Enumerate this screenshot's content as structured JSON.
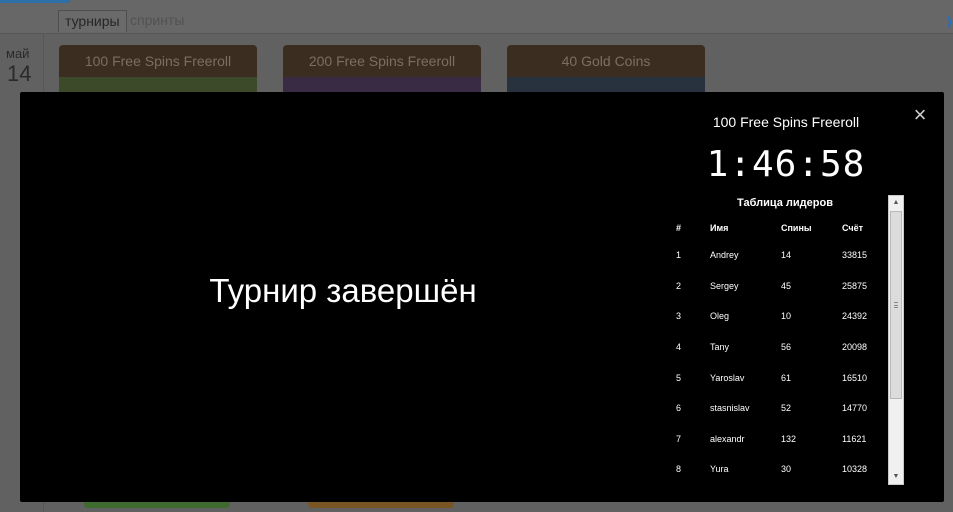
{
  "background": {
    "tabs": [
      {
        "label": "турниры",
        "active": true
      },
      {
        "label": "спринты",
        "active": false
      }
    ],
    "date": {
      "month": "май",
      "day": "14"
    },
    "cards": [
      {
        "title": "100 Free Spins Freeroll"
      },
      {
        "title": "200 Free Spins Freeroll"
      },
      {
        "title": "40 Gold Coins"
      }
    ]
  },
  "modal": {
    "status_text": "Турнир завершён",
    "close_icon": "×",
    "tournament_name": "100 Free Spins Freeroll",
    "timer": "1:46:58",
    "leaderboard": {
      "title": "Таблица лидеров",
      "columns": [
        "#",
        "Имя",
        "Спины",
        "Счёт"
      ],
      "rows": [
        [
          "1",
          "Andrey",
          "14",
          "33815"
        ],
        [
          "2",
          "Sergey",
          "45",
          "25875"
        ],
        [
          "3",
          "Oleg",
          "10",
          "24392"
        ],
        [
          "4",
          "Tany",
          "56",
          "20098"
        ],
        [
          "5",
          "Yaroslav",
          "61",
          "16510"
        ],
        [
          "6",
          "stasnislav",
          "52",
          "14770"
        ],
        [
          "7",
          "alexandr",
          "132",
          "11621"
        ],
        [
          "8",
          "Yura",
          "30",
          "10328"
        ]
      ]
    },
    "scrollbar": {
      "up_icon": "▲",
      "down_icon": "▼"
    }
  },
  "colors": {
    "modal_bg": "#000000",
    "text": "#ffffff",
    "card_header": "#3b2d20",
    "accent_blue": "#1f6fd1"
  }
}
